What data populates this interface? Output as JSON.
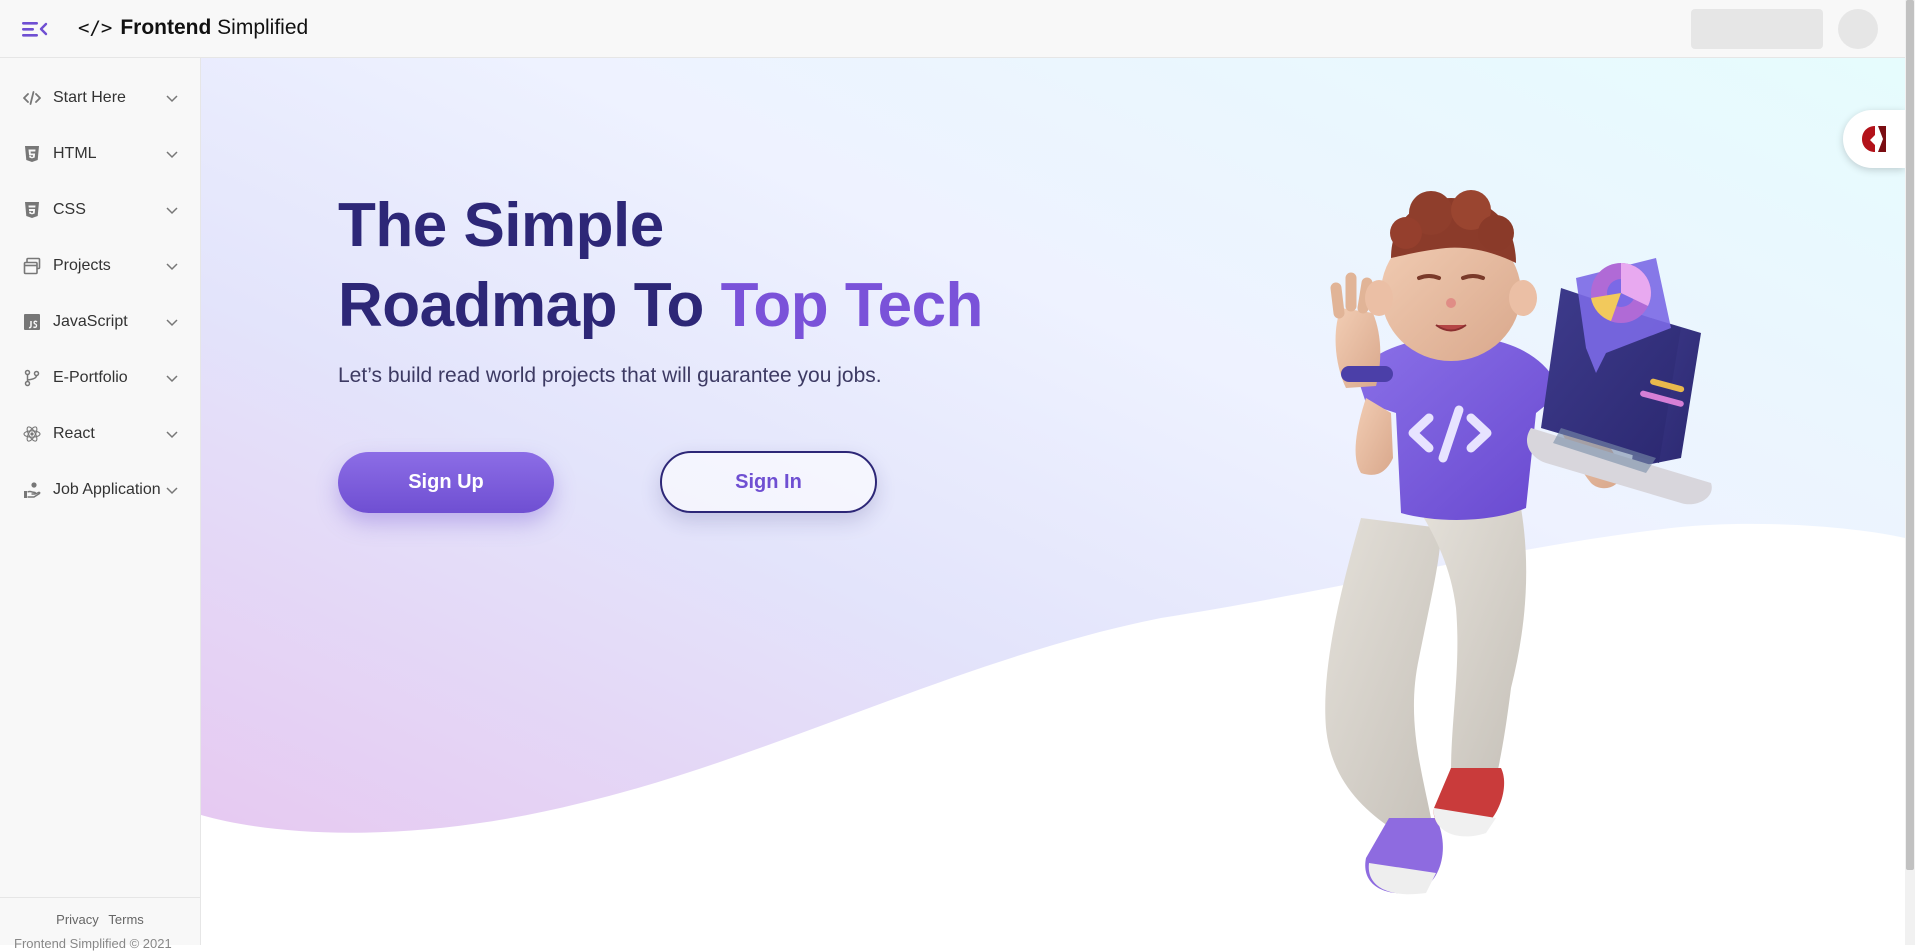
{
  "topbar": {
    "brand_code": "</>",
    "brand_bold": "Frontend",
    "brand_light": "Simplified",
    "menu_icon": "menu-collapse-icon"
  },
  "sidebar": {
    "items": [
      {
        "label": "Start Here",
        "icon": "code-icon"
      },
      {
        "label": "HTML",
        "icon": "html5-icon"
      },
      {
        "label": "CSS",
        "icon": "css3-icon"
      },
      {
        "label": "Projects",
        "icon": "windows-icon"
      },
      {
        "label": "JavaScript",
        "icon": "js-icon"
      },
      {
        "label": "E-Portfolio",
        "icon": "git-branch-icon"
      },
      {
        "label": "React",
        "icon": "react-icon"
      },
      {
        "label": "Job Application",
        "icon": "hand-coin-icon"
      }
    ],
    "footer": {
      "privacy": "Privacy",
      "terms": "Terms",
      "copyright": "Frontend Simplified © 2021"
    }
  },
  "hero": {
    "title_line1": "The Simple",
    "title_line2_prefix": "Roadmap To ",
    "title_line2_accent": "Top Tech",
    "subtitle": "Let’s build read world projects that will guarantee you jobs.",
    "signup_label": "Sign Up",
    "signin_label": "Sign In"
  },
  "colors": {
    "heading": "#2d2777",
    "accent": "#7a52d9",
    "button_gradient_top": "#8c6de6",
    "button_gradient_bottom": "#6f4fd2"
  }
}
